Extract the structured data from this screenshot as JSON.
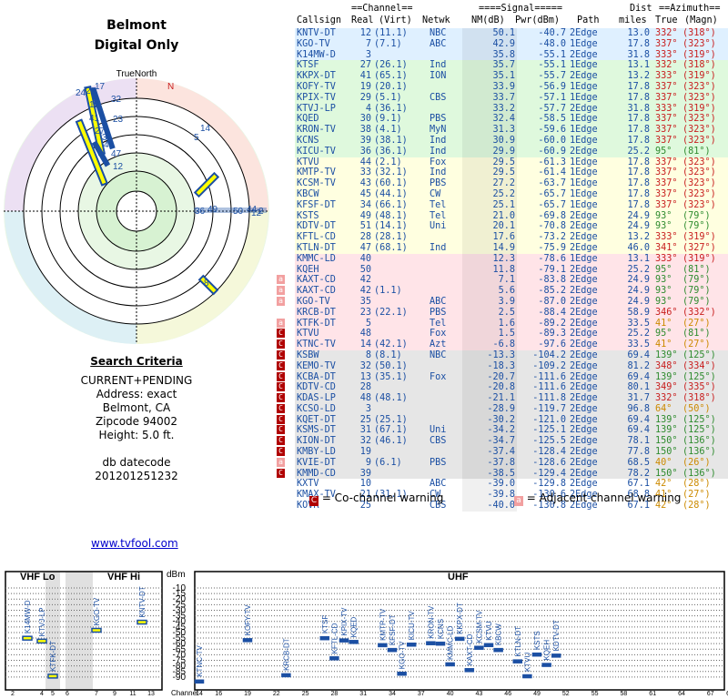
{
  "header": {
    "title": "Belmont",
    "subtitle": "Digital Only",
    "true_north": "TrueNorth",
    "north_marker": "N"
  },
  "criteria": {
    "heading": "Search Criteria",
    "lines": [
      "CURRENT+PENDING",
      "Address: exact",
      "Belmont, CA",
      "Zipcode 94002",
      "Height: 5.0 ft.",
      "",
      "db datecode",
      "201201251232"
    ]
  },
  "link": {
    "text": "www.tvfool.com"
  },
  "table": {
    "group_headers": [
      "==Channel==",
      "====Signal=====",
      "Dist",
      "==Azimuth=="
    ],
    "columns": [
      "Callsign",
      "Real",
      "(Virt)",
      "Netwk",
      "NM(dB)",
      "Pwr(dBm)",
      "Path",
      "miles",
      "True",
      "(Magn)"
    ],
    "rows": [
      {
        "cs": "KNTV-DT",
        "real": "12",
        "virt": "(11.1)",
        "net": "NBC",
        "nm": "50.1",
        "pwr": "-40.7",
        "path": "2Edge",
        "dist": "13.0",
        "true": "332°",
        "mag": "(318°)",
        "bg": "#dff0ff",
        "tc": "#c81e1e",
        "warn": ""
      },
      {
        "cs": "KGO-TV",
        "real": "7",
        "virt": "(7.1)",
        "net": "ABC",
        "nm": "42.9",
        "pwr": "-48.0",
        "path": "1Edge",
        "dist": "17.8",
        "true": "337°",
        "mag": "(323°)",
        "bg": "#dff0ff",
        "tc": "#c81e1e",
        "warn": ""
      },
      {
        "cs": "K14MW-D",
        "real": "3",
        "virt": "",
        "net": "",
        "nm": "35.8",
        "pwr": "-55.1",
        "path": "2Edge",
        "dist": "31.8",
        "true": "333°",
        "mag": "(319°)",
        "bg": "#dff0ff",
        "tc": "#c81e1e",
        "warn": ""
      },
      {
        "cs": "KTSF",
        "real": "27",
        "virt": "(26.1)",
        "net": "Ind",
        "nm": "35.7",
        "pwr": "-55.1",
        "path": "1Edge",
        "dist": "13.1",
        "true": "332°",
        "mag": "(318°)",
        "bg": "#dff9dd",
        "tc": "#c81e1e",
        "warn": ""
      },
      {
        "cs": "KKPX-DT",
        "real": "41",
        "virt": "(65.1)",
        "net": "ION",
        "nm": "35.1",
        "pwr": "-55.7",
        "path": "2Edge",
        "dist": "13.2",
        "true": "333°",
        "mag": "(319°)",
        "bg": "#dff9dd",
        "tc": "#c81e1e",
        "warn": ""
      },
      {
        "cs": "KOFY-TV",
        "real": "19",
        "virt": "(20.1)",
        "net": "",
        "nm": "33.9",
        "pwr": "-56.9",
        "path": "1Edge",
        "dist": "17.8",
        "true": "337°",
        "mag": "(323°)",
        "bg": "#dff9dd",
        "tc": "#c81e1e",
        "warn": ""
      },
      {
        "cs": "KPIX-TV",
        "real": "29",
        "virt": "(5.1)",
        "net": "CBS",
        "nm": "33.7",
        "pwr": "-57.1",
        "path": "1Edge",
        "dist": "17.8",
        "true": "337°",
        "mag": "(323°)",
        "bg": "#dff9dd",
        "tc": "#c81e1e",
        "warn": ""
      },
      {
        "cs": "KTVJ-LP",
        "real": "4",
        "virt": "(36.1)",
        "net": "",
        "nm": "33.2",
        "pwr": "-57.7",
        "path": "2Edge",
        "dist": "31.8",
        "true": "333°",
        "mag": "(319°)",
        "bg": "#dff9dd",
        "tc": "#c81e1e",
        "warn": ""
      },
      {
        "cs": "KQED",
        "real": "30",
        "virt": "(9.1)",
        "net": "PBS",
        "nm": "32.4",
        "pwr": "-58.5",
        "path": "1Edge",
        "dist": "17.8",
        "true": "337°",
        "mag": "(323°)",
        "bg": "#dff9dd",
        "tc": "#c81e1e",
        "warn": ""
      },
      {
        "cs": "KRON-TV",
        "real": "38",
        "virt": "(4.1)",
        "net": "MyN",
        "nm": "31.3",
        "pwr": "-59.6",
        "path": "1Edge",
        "dist": "17.8",
        "true": "337°",
        "mag": "(323°)",
        "bg": "#dff9dd",
        "tc": "#c81e1e",
        "warn": ""
      },
      {
        "cs": "KCNS",
        "real": "39",
        "virt": "(38.1)",
        "net": "Ind",
        "nm": "30.9",
        "pwr": "-60.0",
        "path": "1Edge",
        "dist": "17.8",
        "true": "337°",
        "mag": "(323°)",
        "bg": "#dff9dd",
        "tc": "#c81e1e",
        "warn": ""
      },
      {
        "cs": "KICU-TV",
        "real": "36",
        "virt": "(36.1)",
        "net": "Ind",
        "nm": "29.9",
        "pwr": "-60.9",
        "path": "2Edge",
        "dist": "25.2",
        "true": "95°",
        "mag": "(81°)",
        "bg": "#dff9dd",
        "tc": "#2e8b2e",
        "warn": ""
      },
      {
        "cs": "KTVU",
        "real": "44",
        "virt": "(2.1)",
        "net": "Fox",
        "nm": "29.5",
        "pwr": "-61.3",
        "path": "1Edge",
        "dist": "17.8",
        "true": "337°",
        "mag": "(323°)",
        "bg": "#ffffe0",
        "tc": "#c81e1e",
        "warn": ""
      },
      {
        "cs": "KMTP-TV",
        "real": "33",
        "virt": "(32.1)",
        "net": "Ind",
        "nm": "29.5",
        "pwr": "-61.4",
        "path": "1Edge",
        "dist": "17.8",
        "true": "337°",
        "mag": "(323°)",
        "bg": "#ffffe0",
        "tc": "#c81e1e",
        "warn": ""
      },
      {
        "cs": "KCSM-TV",
        "real": "43",
        "virt": "(60.1)",
        "net": "PBS",
        "nm": "27.2",
        "pwr": "-63.7",
        "path": "1Edge",
        "dist": "17.8",
        "true": "337°",
        "mag": "(323°)",
        "bg": "#ffffe0",
        "tc": "#c81e1e",
        "warn": ""
      },
      {
        "cs": "KBCW",
        "real": "45",
        "virt": "(44.1)",
        "net": "CW",
        "nm": "25.2",
        "pwr": "-65.7",
        "path": "1Edge",
        "dist": "17.8",
        "true": "337°",
        "mag": "(323°)",
        "bg": "#ffffe0",
        "tc": "#c81e1e",
        "warn": ""
      },
      {
        "cs": "KFSF-DT",
        "real": "34",
        "virt": "(66.1)",
        "net": "Tel",
        "nm": "25.1",
        "pwr": "-65.7",
        "path": "1Edge",
        "dist": "17.8",
        "true": "337°",
        "mag": "(323°)",
        "bg": "#ffffe0",
        "tc": "#c81e1e",
        "warn": ""
      },
      {
        "cs": "KSTS",
        "real": "49",
        "virt": "(48.1)",
        "net": "Tel",
        "nm": "21.0",
        "pwr": "-69.8",
        "path": "2Edge",
        "dist": "24.9",
        "true": "93°",
        "mag": "(79°)",
        "bg": "#ffffe0",
        "tc": "#2e8b2e",
        "warn": ""
      },
      {
        "cs": "KDTV-DT",
        "real": "51",
        "virt": "(14.1)",
        "net": "Uni",
        "nm": "20.1",
        "pwr": "-70.8",
        "path": "2Edge",
        "dist": "24.9",
        "true": "93°",
        "mag": "(79°)",
        "bg": "#ffffe0",
        "tc": "#2e8b2e",
        "warn": ""
      },
      {
        "cs": "KFTL-CD",
        "real": "28",
        "virt": "(28.1)",
        "net": "",
        "nm": "17.6",
        "pwr": "-73.2",
        "path": "2Edge",
        "dist": "13.2",
        "true": "333°",
        "mag": "(319°)",
        "bg": "#ffffe0",
        "tc": "#c81e1e",
        "warn": ""
      },
      {
        "cs": "KTLN-DT",
        "real": "47",
        "virt": "(68.1)",
        "net": "Ind",
        "nm": "14.9",
        "pwr": "-75.9",
        "path": "2Edge",
        "dist": "46.0",
        "true": "341°",
        "mag": "(327°)",
        "bg": "#ffffe0",
        "tc": "#c81e1e",
        "warn": ""
      },
      {
        "cs": "KMMC-LD",
        "real": "40",
        "virt": "",
        "net": "",
        "nm": "12.3",
        "pwr": "-78.6",
        "path": "1Edge",
        "dist": "13.1",
        "true": "333°",
        "mag": "(319°)",
        "bg": "#ffe4e8",
        "tc": "#c81e1e",
        "warn": ""
      },
      {
        "cs": "KQEH",
        "real": "50",
        "virt": "",
        "net": "",
        "nm": "11.8",
        "pwr": "-79.1",
        "path": "2Edge",
        "dist": "25.2",
        "true": "95°",
        "mag": "(81°)",
        "bg": "#ffe4e8",
        "tc": "#2e8b2e",
        "warn": ""
      },
      {
        "cs": "KAXT-CD",
        "real": "42",
        "virt": "",
        "net": "",
        "nm": "7.1",
        "pwr": "-83.8",
        "path": "2Edge",
        "dist": "24.9",
        "true": "93°",
        "mag": "(79°)",
        "bg": "#ffe4e8",
        "tc": "#2e8b2e",
        "warn": "a"
      },
      {
        "cs": "KAXT-CD",
        "real": "42",
        "virt": "(1.1)",
        "net": "",
        "nm": "5.6",
        "pwr": "-85.2",
        "path": "2Edge",
        "dist": "24.9",
        "true": "93°",
        "mag": "(79°)",
        "bg": "#ffe4e8",
        "tc": "#2e8b2e",
        "warn": "a"
      },
      {
        "cs": "KGO-TV",
        "real": "35",
        "virt": "",
        "net": "ABC",
        "nm": "3.9",
        "pwr": "-87.0",
        "path": "2Edge",
        "dist": "24.9",
        "true": "93°",
        "mag": "(79°)",
        "bg": "#ffe4e8",
        "tc": "#2e8b2e",
        "warn": "a"
      },
      {
        "cs": "KRCB-DT",
        "real": "23",
        "virt": "(22.1)",
        "net": "PBS",
        "nm": "2.5",
        "pwr": "-88.4",
        "path": "2Edge",
        "dist": "58.9",
        "true": "346°",
        "mag": "(332°)",
        "bg": "#ffe4e8",
        "tc": "#c81e1e",
        "warn": ""
      },
      {
        "cs": "KTFK-DT",
        "real": "5",
        "virt": "",
        "net": "Tel",
        "nm": "1.6",
        "pwr": "-89.2",
        "path": "2Edge",
        "dist": "33.5",
        "true": "41°",
        "mag": "(27°)",
        "bg": "#ffe4e8",
        "tc": "#cc8a00",
        "warn": "a"
      },
      {
        "cs": "KTVU",
        "real": "48",
        "virt": "",
        "net": "Fox",
        "nm": "1.5",
        "pwr": "-89.3",
        "path": "2Edge",
        "dist": "25.2",
        "true": "95°",
        "mag": "(81°)",
        "bg": "#ffe4e8",
        "tc": "#2e8b2e",
        "warn": "c"
      },
      {
        "cs": "KTNC-TV",
        "real": "14",
        "virt": "(42.1)",
        "net": "Azt",
        "nm": "-6.8",
        "pwr": "-97.6",
        "path": "2Edge",
        "dist": "33.5",
        "true": "41°",
        "mag": "(27°)",
        "bg": "#ffe4e8",
        "tc": "#cc8a00",
        "warn": "c"
      },
      {
        "cs": "KSBW",
        "real": "8",
        "virt": "(8.1)",
        "net": "NBC",
        "nm": "-13.3",
        "pwr": "-104.2",
        "path": "2Edge",
        "dist": "69.4",
        "true": "139°",
        "mag": "(125°)",
        "bg": "#e6e6e6",
        "tc": "#2e8b2e",
        "warn": "c"
      },
      {
        "cs": "KEMO-TV",
        "real": "32",
        "virt": "(50.1)",
        "net": "",
        "nm": "-18.3",
        "pwr": "-109.2",
        "path": "2Edge",
        "dist": "81.2",
        "true": "348°",
        "mag": "(334°)",
        "bg": "#e6e6e6",
        "tc": "#c81e1e",
        "warn": "c"
      },
      {
        "cs": "KCBA-DT",
        "real": "13",
        "virt": "(35.1)",
        "net": "Fox",
        "nm": "-20.7",
        "pwr": "-111.6",
        "path": "2Edge",
        "dist": "69.4",
        "true": "139°",
        "mag": "(125°)",
        "bg": "#e6e6e6",
        "tc": "#2e8b2e",
        "warn": "c"
      },
      {
        "cs": "KDTV-CD",
        "real": "28",
        "virt": "",
        "net": "",
        "nm": "-20.8",
        "pwr": "-111.6",
        "path": "2Edge",
        "dist": "80.1",
        "true": "349°",
        "mag": "(335°)",
        "bg": "#e6e6e6",
        "tc": "#c81e1e",
        "warn": "c"
      },
      {
        "cs": "KDAS-LP",
        "real": "48",
        "virt": "(48.1)",
        "net": "",
        "nm": "-21.1",
        "pwr": "-111.8",
        "path": "2Edge",
        "dist": "31.7",
        "true": "332°",
        "mag": "(318°)",
        "bg": "#e6e6e6",
        "tc": "#c81e1e",
        "warn": "c"
      },
      {
        "cs": "KCSO-LD",
        "real": "3",
        "virt": "",
        "net": "",
        "nm": "-28.9",
        "pwr": "-119.7",
        "path": "2Edge",
        "dist": "96.8",
        "true": "64°",
        "mag": "(50°)",
        "bg": "#e6e6e6",
        "tc": "#cc8a00",
        "warn": "c"
      },
      {
        "cs": "KQET-DT",
        "real": "25",
        "virt": "(25.1)",
        "net": "",
        "nm": "-30.2",
        "pwr": "-121.0",
        "path": "2Edge",
        "dist": "69.4",
        "true": "139°",
        "mag": "(125°)",
        "bg": "#e6e6e6",
        "tc": "#2e8b2e",
        "warn": "c"
      },
      {
        "cs": "KSMS-DT",
        "real": "31",
        "virt": "(67.1)",
        "net": "Uni",
        "nm": "-34.2",
        "pwr": "-125.1",
        "path": "2Edge",
        "dist": "69.4",
        "true": "139°",
        "mag": "(125°)",
        "bg": "#e6e6e6",
        "tc": "#2e8b2e",
        "warn": "c"
      },
      {
        "cs": "KION-DT",
        "real": "32",
        "virt": "(46.1)",
        "net": "CBS",
        "nm": "-34.7",
        "pwr": "-125.5",
        "path": "2Edge",
        "dist": "78.1",
        "true": "150°",
        "mag": "(136°)",
        "bg": "#e6e6e6",
        "tc": "#2e8b2e",
        "warn": "c"
      },
      {
        "cs": "KMBY-LD",
        "real": "19",
        "virt": "",
        "net": "",
        "nm": "-37.4",
        "pwr": "-128.4",
        "path": "2Edge",
        "dist": "77.8",
        "true": "150°",
        "mag": "(136°)",
        "bg": "#e6e6e6",
        "tc": "#2e8b2e",
        "warn": "c"
      },
      {
        "cs": "KVIE-DT",
        "real": "9",
        "virt": "(6.1)",
        "net": "PBS",
        "nm": "-37.8",
        "pwr": "-128.6",
        "path": "2Edge",
        "dist": "68.5",
        "true": "40°",
        "mag": "(26°)",
        "bg": "#e6e6e6",
        "tc": "#cc8a00",
        "warn": "a"
      },
      {
        "cs": "KMMD-CD",
        "real": "39",
        "virt": "",
        "net": "",
        "nm": "-38.5",
        "pwr": "-129.4",
        "path": "2Edge",
        "dist": "78.2",
        "true": "150°",
        "mag": "(136°)",
        "bg": "#e6e6e6",
        "tc": "#2e8b2e",
        "warn": "c"
      },
      {
        "cs": "KXTV",
        "real": "10",
        "virt": "",
        "net": "ABC",
        "nm": "-39.0",
        "pwr": "-129.8",
        "path": "2Edge",
        "dist": "67.1",
        "true": "42°",
        "mag": "(28°)",
        "bg": "#ffffff",
        "tc": "#cc8a00",
        "warn": ""
      },
      {
        "cs": "KMAX-TV",
        "real": "21",
        "virt": "(31.1)",
        "net": "CW",
        "nm": "-39.8",
        "pwr": "-130.6",
        "path": "2Edge",
        "dist": "68.8",
        "true": "41°",
        "mag": "(27°)",
        "bg": "#ffffff",
        "tc": "#cc8a00",
        "warn": ""
      },
      {
        "cs": "KOVR",
        "real": "25",
        "virt": "",
        "net": "CBS",
        "nm": "-40.0",
        "pwr": "-130.8",
        "path": "2Edge",
        "dist": "67.1",
        "true": "42°",
        "mag": "(28°)",
        "bg": "#ffffff",
        "tc": "#cc8a00",
        "warn": ""
      }
    ]
  },
  "legend": {
    "co_glyph": "C",
    "co_text": " = Co-channel warning",
    "adj_glyph": "a",
    "adj_text": " = Adjacent channel warning"
  },
  "radar_labels": [
    "24",
    "29",
    "19",
    "41",
    "27",
    "3",
    "4",
    "47",
    "12",
    "32",
    "23",
    "14",
    "5",
    "36",
    "49",
    "50",
    "44",
    "2",
    "12",
    "8",
    "17"
  ],
  "chart_data": {
    "type": "bar",
    "ylabel": "dBm",
    "ylim": [
      -95,
      -10
    ],
    "yticks": [
      "-10",
      "-15",
      "-20",
      "-25",
      "-30",
      "-35",
      "-40",
      "-45",
      "-50",
      "-55",
      "-60",
      "-65",
      "-70",
      "-75",
      "-80",
      "-85",
      "-90"
    ],
    "panels": {
      "vhf_lo": "VHF Lo",
      "vhf_hi": "VHF Hi",
      "uhf": "UHF"
    },
    "xlabel": "Channel",
    "xticks": [
      "2",
      "4",
      "5",
      "6",
      "7",
      "9",
      "11",
      "13",
      "14",
      "16",
      "19",
      "22",
      "25",
      "28",
      "31",
      "34",
      "37",
      "40",
      "43",
      "46",
      "49",
      "52",
      "55",
      "58",
      "61",
      "64",
      "67",
      "69"
    ],
    "stations": [
      {
        "name": "K14MW-D",
        "ch": 3,
        "pwr": -55.1
      },
      {
        "name": "KTVJ-LP",
        "ch": 4,
        "pwr": -57.7
      },
      {
        "name": "KTFK-DT",
        "ch": 5,
        "pwr": -89.2
      },
      {
        "name": "KGO-TV",
        "ch": 7,
        "pwr": -48.0
      },
      {
        "name": "KNTV-DT",
        "ch": 12,
        "pwr": -40.7
      },
      {
        "name": "KTNC-TV",
        "ch": 14,
        "pwr": -97.6
      },
      {
        "name": "KOFY-TV",
        "ch": 19,
        "pwr": -56.9
      },
      {
        "name": "KRCB-DT",
        "ch": 23,
        "pwr": -88.4
      },
      {
        "name": "KTSF",
        "ch": 27,
        "pwr": -55.1
      },
      {
        "name": "KFTL-CD",
        "ch": 28,
        "pwr": -73.2
      },
      {
        "name": "KPIX-TV",
        "ch": 29,
        "pwr": -57.1
      },
      {
        "name": "KQED",
        "ch": 30,
        "pwr": -58.5
      },
      {
        "name": "KMTP-TV",
        "ch": 33,
        "pwr": -61.4
      },
      {
        "name": "KFSF-DT",
        "ch": 34,
        "pwr": -65.7
      },
      {
        "name": "KGO-TV",
        "ch": 35,
        "pwr": -87.0
      },
      {
        "name": "KICU-TV",
        "ch": 36,
        "pwr": -60.9
      },
      {
        "name": "KRON-TV",
        "ch": 38,
        "pwr": -59.6
      },
      {
        "name": "KCNS",
        "ch": 39,
        "pwr": -60.0
      },
      {
        "name": "KMMC-LD",
        "ch": 40,
        "pwr": -78.6
      },
      {
        "name": "KKPX-DT",
        "ch": 41,
        "pwr": -55.7
      },
      {
        "name": "KAXT-CD",
        "ch": 42,
        "pwr": -83.8
      },
      {
        "name": "KCSM-TV",
        "ch": 43,
        "pwr": -63.7
      },
      {
        "name": "KTVU",
        "ch": 44,
        "pwr": -61.3
      },
      {
        "name": "KBCW",
        "ch": 45,
        "pwr": -65.7
      },
      {
        "name": "KTLN-DT",
        "ch": 47,
        "pwr": -75.9
      },
      {
        "name": "KTVU",
        "ch": 48,
        "pwr": -89.3
      },
      {
        "name": "KSTS",
        "ch": 49,
        "pwr": -69.8
      },
      {
        "name": "KQEH",
        "ch": 50,
        "pwr": -79.1
      },
      {
        "name": "KDTV-DT",
        "ch": 51,
        "pwr": -70.8
      }
    ]
  },
  "colors": {
    "accent": "#1b4fa3",
    "co_warn": "#b00000",
    "adj_warn": "#f2a0a0",
    "bar": "#1b4fa3",
    "bar_highlight": "#ffff00"
  }
}
